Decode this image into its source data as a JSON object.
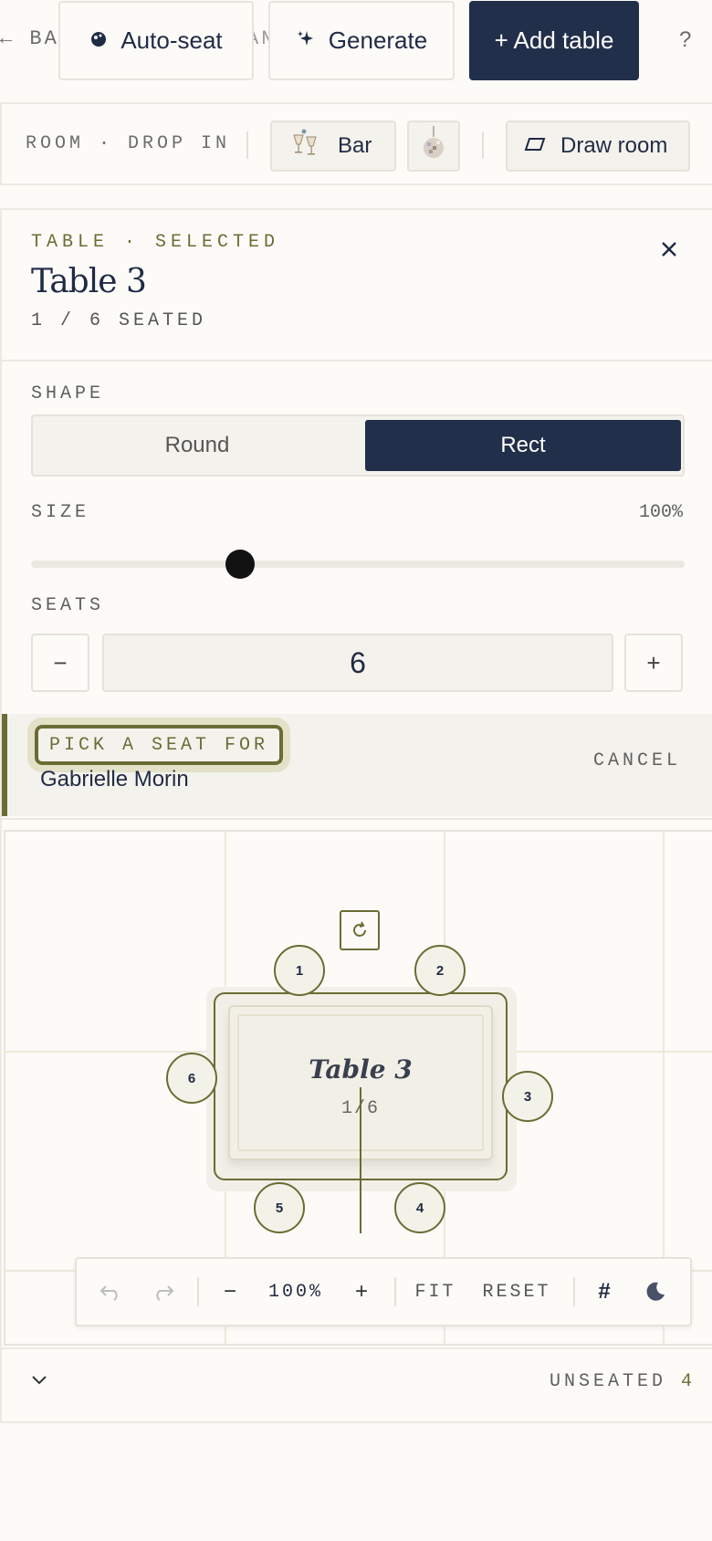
{
  "toolbar": {
    "back_label": "← BAC",
    "back_tail": "AN",
    "auto_seat_label": "Auto-seat",
    "generate_label": "Generate",
    "add_table_label": "+ Add table",
    "help_label": "?"
  },
  "room": {
    "label": "ROOM · DROP IN",
    "bar_label": "Bar",
    "draw_room_label": "Draw room"
  },
  "panel": {
    "eyebrow": "TABLE · SELECTED",
    "title": "Table 3",
    "seated": "1 / 6 SEATED",
    "shape_label": "SHAPE",
    "shape_options": [
      "Round",
      "Rect"
    ],
    "shape_selected": "Rect",
    "size_label": "SIZE",
    "size_value": "100%",
    "size_fraction": 0.32,
    "seats_label": "SEATS",
    "seats_minus": "−",
    "seats_value": "6",
    "seats_plus": "+"
  },
  "pick": {
    "label": "PICK A SEAT FOR",
    "guest_name": "Gabrielle Morin",
    "cancel_label": "CANCEL"
  },
  "canvas": {
    "table_name": "Table 3",
    "table_count": "1/6",
    "seats": [
      "1",
      "2",
      "3",
      "4",
      "5",
      "6"
    ]
  },
  "canvas_tools": {
    "zoom_minus": "−",
    "zoom_value": "100%",
    "zoom_plus": "+",
    "fit_label": "FIT",
    "reset_label": "RESET",
    "grid_label": "#"
  },
  "bottom": {
    "unseated_label": "UNSEATED",
    "unseated_count": "4"
  },
  "colors": {
    "accent": "#6b6c34",
    "primary": "#222f4a"
  }
}
